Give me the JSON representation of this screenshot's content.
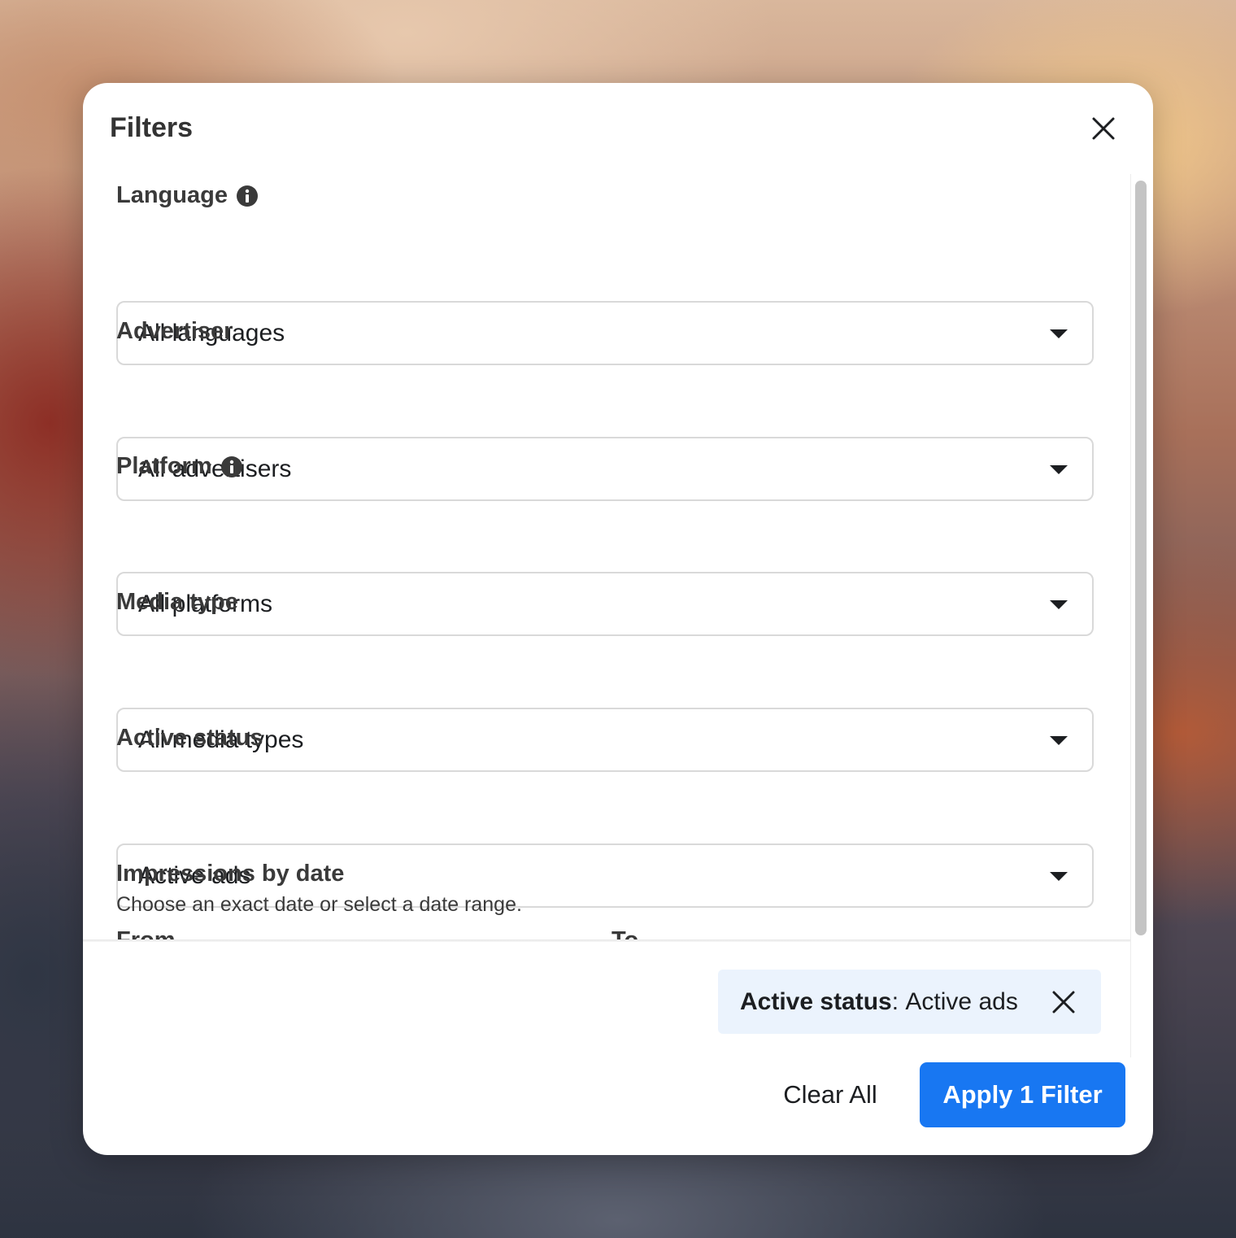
{
  "dialog": {
    "title": "Filters"
  },
  "filters": {
    "language": {
      "label": "Language",
      "value": "All languages"
    },
    "advertiser": {
      "label": "Advertiser",
      "value": "All advertisers"
    },
    "platform": {
      "label": "Platform",
      "value": "All platforms"
    },
    "media_type": {
      "label": "Media type",
      "value": "All media types"
    },
    "active_status": {
      "label": "Active status",
      "value": "Active ads"
    },
    "impressions": {
      "label": "Impressions by date",
      "help": "Choose an exact date or select a date range.",
      "from_label": "From",
      "to_label": "To"
    }
  },
  "applied_chip": {
    "key": "Active status",
    "separator": ": ",
    "value": "Active ads"
  },
  "footer": {
    "clear_label": "Clear All",
    "apply_label": "Apply 1 Filter"
  },
  "colors": {
    "accent": "#1877f2",
    "chip_bg": "#ebf3fd"
  },
  "icons": {
    "close": "close-icon",
    "info": "info-icon",
    "caret": "caret-down-icon"
  }
}
